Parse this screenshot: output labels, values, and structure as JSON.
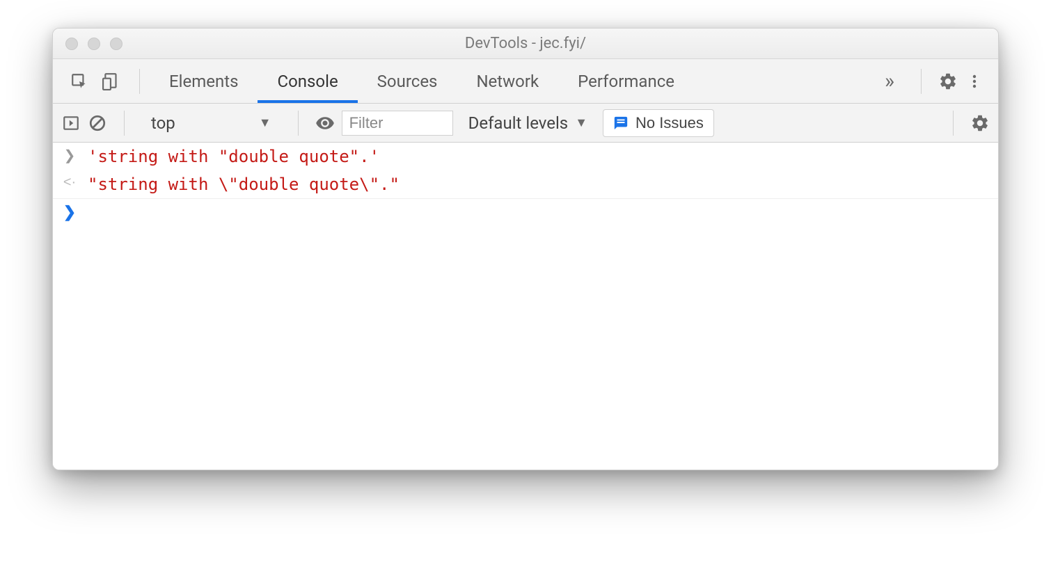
{
  "window": {
    "title": "DevTools - jec.fyi/"
  },
  "tabs": {
    "elements": "Elements",
    "console": "Console",
    "sources": "Sources",
    "network": "Network",
    "performance": "Performance"
  },
  "toolbar": {
    "context": "top",
    "filter_placeholder": "Filter",
    "levels": "Default levels",
    "issues": "No Issues"
  },
  "console": {
    "input_line": "'string with \"double quote\".'",
    "output_line": "\"string with \\\"double quote\\\".\""
  }
}
